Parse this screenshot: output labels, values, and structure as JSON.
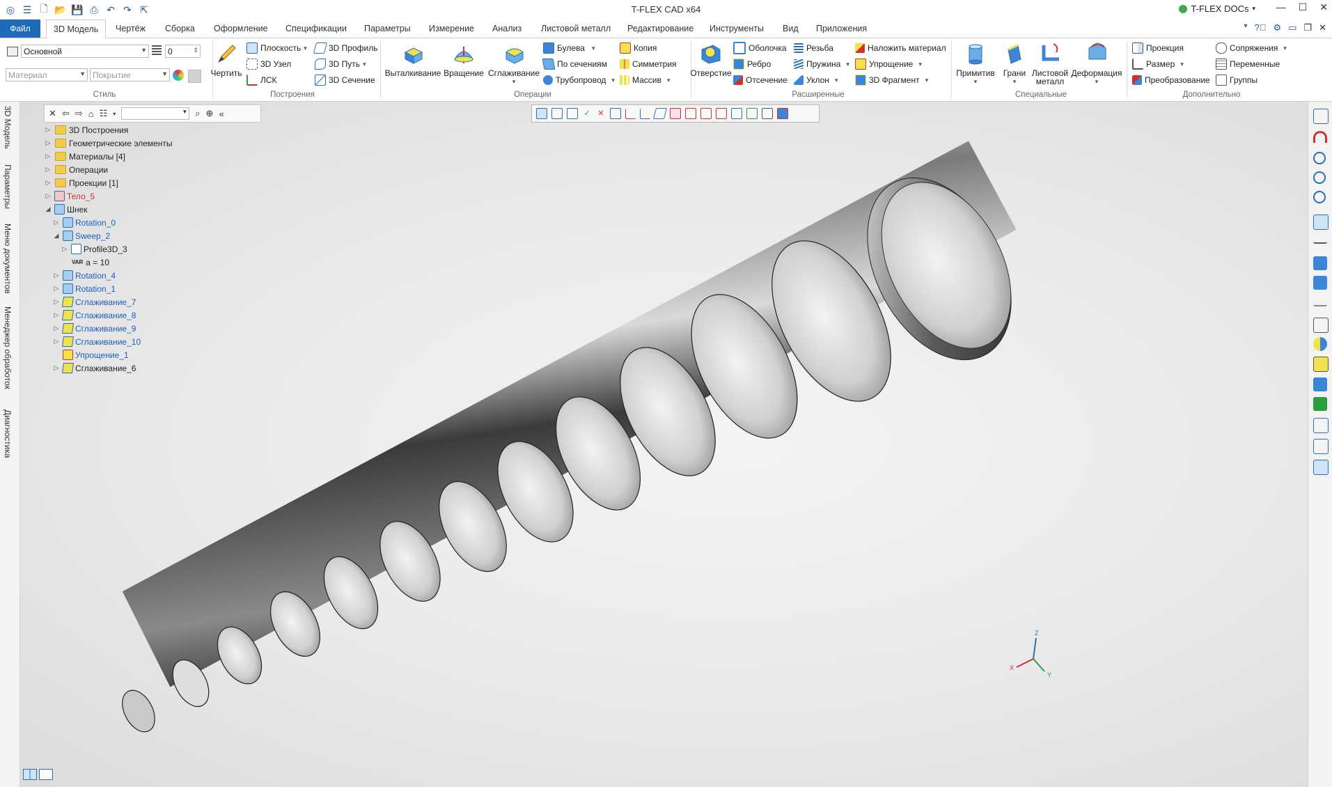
{
  "window": {
    "title": "T-FLEX CAD x64",
    "docs_label": "T-FLEX DOCs",
    "controls": [
      "—",
      "☐",
      "✕"
    ]
  },
  "quick_access": [
    "menu-icon",
    "new-icon",
    "open-icon",
    "save-icon",
    "print-icon",
    "undo-icon",
    "redo-icon",
    "export-icon"
  ],
  "tabs": {
    "file": "Файл",
    "items": [
      "3D Модель",
      "Чертёж",
      "Сборка",
      "Оформление",
      "Спецификации",
      "Параметры",
      "Измерение",
      "Анализ",
      "Листовой металл",
      "Редактирование",
      "Инструменты",
      "Вид",
      "Приложения"
    ],
    "active": "3D Модель"
  },
  "ribbon": {
    "style": {
      "label": "Стиль",
      "layer": "Основной",
      "level": "0",
      "material_placeholder": "Материал",
      "coating_placeholder": "Покрытие"
    },
    "build": {
      "label": "Построения",
      "draw": "Чертить",
      "plane": "Плоскость",
      "node3d": "3D Узел",
      "lsk": "ЛСК",
      "profile3d": "3D Профиль",
      "path3d": "3D Путь",
      "section3d": "3D Сечение"
    },
    "operations": {
      "label": "Операции",
      "extrude": "Выталкивание",
      "rotate": "Вращение",
      "smooth": "Сглаживание",
      "boolean": "Булева",
      "by_sections": "По сечениям",
      "pipe": "Трубопровод",
      "copy": "Копия",
      "symmetry": "Симметрия",
      "array": "Массив"
    },
    "extended": {
      "label": "Расширенные",
      "hole": "Отверстие",
      "shell": "Оболочка",
      "rib": "Ребро",
      "cut": "Отсечение",
      "thread": "Резьба",
      "spring": "Пружина",
      "slope": "Уклон",
      "apply_material": "Наложить материал",
      "simplify": "Упрощение",
      "fragment3d": "3D Фрагмент"
    },
    "special": {
      "label": "Специальные",
      "primitives": "Примитив",
      "faces": "Грани",
      "sheet_metal": "Листовой металл",
      "deformation": "Деформация"
    },
    "additional": {
      "label": "Дополнительно",
      "projection": "Проекция",
      "dimension": "Размер",
      "transform": "Преобразование",
      "mates": "Сопряжения",
      "variables": "Переменные",
      "groups": "Группы"
    }
  },
  "left_tabs": [
    "3D Модель",
    "Параметры",
    "Меню документов",
    "Менеджер обработок",
    "Диагностика"
  ],
  "tree": [
    {
      "label": "3D Построения",
      "indent": 0,
      "type": "folder",
      "style": "normal"
    },
    {
      "label": "Геометрические элементы",
      "indent": 0,
      "type": "folder",
      "style": "normal"
    },
    {
      "label": "Материалы [4]",
      "indent": 0,
      "type": "folder",
      "style": "normal"
    },
    {
      "label": "Операции",
      "indent": 0,
      "type": "folder",
      "style": "normal"
    },
    {
      "label": "Проекции [1]",
      "indent": 0,
      "type": "folder",
      "style": "normal"
    },
    {
      "label": "Тело_5",
      "indent": 0,
      "type": "body",
      "style": "red"
    },
    {
      "label": "Шнек",
      "indent": 0,
      "type": "body",
      "style": "normal"
    },
    {
      "label": "Rotation_0",
      "indent": 1,
      "type": "op",
      "style": "blue"
    },
    {
      "label": "Sweep_2",
      "indent": 1,
      "type": "op",
      "style": "blue"
    },
    {
      "label": "Profile3D_3",
      "indent": 2,
      "type": "profile",
      "style": "normal"
    },
    {
      "label": "a = 10",
      "indent": 2,
      "type": "var",
      "style": "normal"
    },
    {
      "label": "Rotation_4",
      "indent": 1,
      "type": "op",
      "style": "blue"
    },
    {
      "label": "Rotation_1",
      "indent": 1,
      "type": "op",
      "style": "blue"
    },
    {
      "label": "Сглаживание_7",
      "indent": 1,
      "type": "smooth",
      "style": "blue"
    },
    {
      "label": "Сглаживание_8",
      "indent": 1,
      "type": "smooth",
      "style": "blue"
    },
    {
      "label": "Сглаживание_9",
      "indent": 1,
      "type": "smooth",
      "style": "blue"
    },
    {
      "label": "Сглаживание_10",
      "indent": 1,
      "type": "smooth",
      "style": "blue"
    },
    {
      "label": "Упрощение_1",
      "indent": 1,
      "type": "simplify",
      "style": "blue"
    },
    {
      "label": "Сглаживание_6",
      "indent": 1,
      "type": "smooth",
      "style": "normal"
    }
  ],
  "var_prefix": "VAR",
  "axes": {
    "x": "X",
    "y": "Y",
    "z": "Z"
  },
  "colors": {
    "accent": "#1e6bb8",
    "tree_link": "#1a5fbf",
    "tree_error": "#d0312d"
  }
}
